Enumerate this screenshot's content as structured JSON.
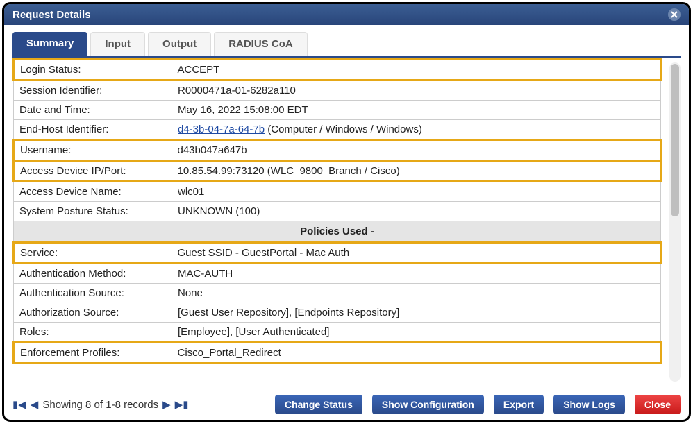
{
  "window": {
    "title": "Request Details"
  },
  "tabs": [
    {
      "label": "Summary"
    },
    {
      "label": "Input"
    },
    {
      "label": "Output"
    },
    {
      "label": "RADIUS CoA"
    }
  ],
  "rows": {
    "login_status": {
      "label": "Login Status:",
      "value": "ACCEPT"
    },
    "session_id": {
      "label": "Session Identifier:",
      "value": "R0000471a-01-6282a110"
    },
    "date_time": {
      "label": "Date and Time:",
      "value": "May 16, 2022 15:08:00 EDT"
    },
    "end_host": {
      "label": "End-Host Identifier:",
      "mac": "d4-3b-04-7a-64-7b",
      "extra": "   (Computer / Windows / Windows)"
    },
    "username": {
      "label": "Username:",
      "value": "d43b047a647b"
    },
    "access_ip": {
      "label": "Access Device IP/Port:",
      "value": "10.85.54.99:73120    (WLC_9800_Branch / Cisco)"
    },
    "access_name": {
      "label": "Access Device Name:",
      "value": "wlc01"
    },
    "posture": {
      "label": "System Posture Status:",
      "value": "UNKNOWN (100)"
    },
    "policies_header": {
      "label": "Policies Used -"
    },
    "service": {
      "label": "Service:",
      "value": "Guest SSID - GuestPortal - Mac Auth"
    },
    "auth_method": {
      "label": "Authentication Method:",
      "value": "MAC-AUTH"
    },
    "auth_source": {
      "label": "Authentication Source:",
      "value": "None"
    },
    "authz_source": {
      "label": "Authorization Source:",
      "value": "[Guest User Repository], [Endpoints Repository]"
    },
    "roles": {
      "label": "Roles:",
      "value": "[Employee], [User Authenticated]"
    },
    "enf_profiles": {
      "label": "Enforcement Profiles:",
      "value": "Cisco_Portal_Redirect"
    }
  },
  "footer": {
    "records_text": "Showing 8 of 1-8 records",
    "buttons": {
      "change_status": "Change Status",
      "show_config": "Show Configuration",
      "export": "Export",
      "show_logs": "Show Logs",
      "close": "Close"
    }
  }
}
